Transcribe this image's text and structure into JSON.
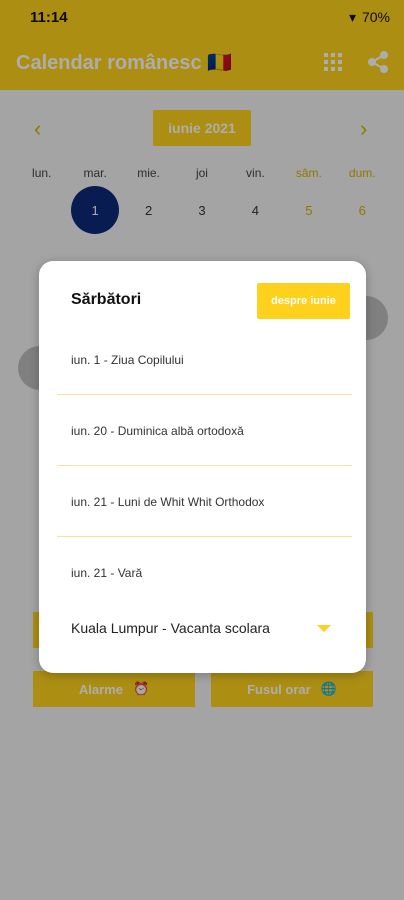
{
  "status": {
    "time": "11:14",
    "battery": "70%"
  },
  "app": {
    "title": "Calendar românesc 🇷🇴"
  },
  "calendar": {
    "month_label": "iunie 2021",
    "weekdays": [
      "lun.",
      "mar.",
      "mie.",
      "joi",
      "vin.",
      "sâm.",
      "dum."
    ],
    "days": [
      "",
      "1",
      "2",
      "3",
      "4",
      "5",
      "6"
    ]
  },
  "bottom_buttons": {
    "alarm": "Alarme",
    "timezone": "Fusul orar"
  },
  "dialog": {
    "title": "Sărbători",
    "about_button": "despre iunie",
    "holidays": [
      "iun. 1 - Ziua Copilului",
      "iun. 20 - Duminica albă ortodoxă",
      "iun. 21 - Luni de Whit Whit Orthodox",
      "iun. 21 - Vară"
    ],
    "region_select": "Kuala Lumpur - Vacanta scolara"
  },
  "colors": {
    "accent": "#fed11c",
    "today": "#0d2a7a"
  }
}
